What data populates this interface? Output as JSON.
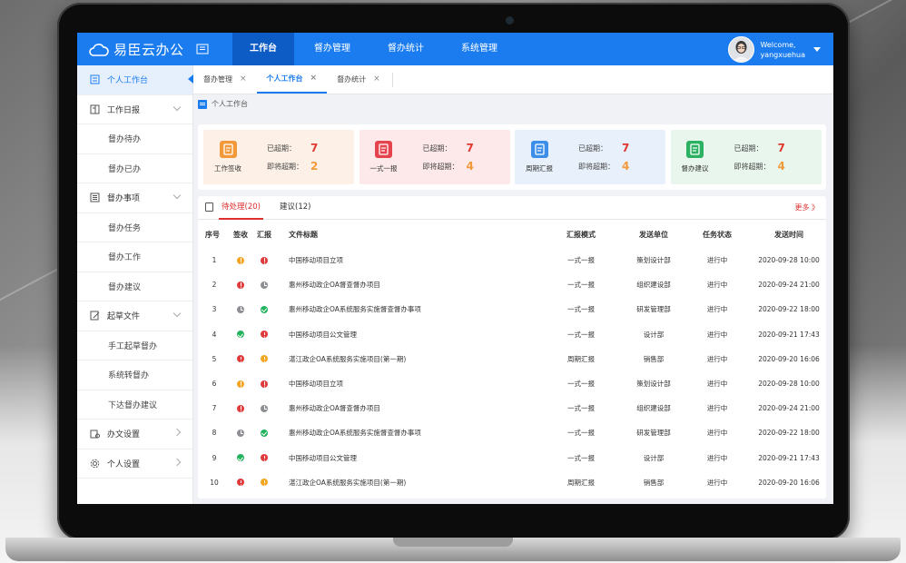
{
  "app": {
    "title": "易臣云办公"
  },
  "nav": [
    {
      "label": "工作台",
      "active": true
    },
    {
      "label": "督办管理",
      "active": false
    },
    {
      "label": "督办统计",
      "active": false
    },
    {
      "label": "系统管理",
      "active": false
    }
  ],
  "user": {
    "welcome": "Welcome,",
    "name": "yangxuehua"
  },
  "sidebar": [
    {
      "label": "个人工作台",
      "type": "top",
      "icon": "home-icon",
      "active": true,
      "arrow": ""
    },
    {
      "label": "工作日报",
      "type": "top",
      "icon": "report-icon",
      "active": false,
      "arrow": "down"
    },
    {
      "label": "督办待办",
      "type": "sub",
      "active": false
    },
    {
      "label": "督办已办",
      "type": "sub",
      "active": false
    },
    {
      "label": "督办事项",
      "type": "top",
      "icon": "list-icon",
      "active": false,
      "arrow": "down"
    },
    {
      "label": "督办任务",
      "type": "sub",
      "active": false
    },
    {
      "label": "督办工作",
      "type": "sub",
      "active": false
    },
    {
      "label": "督办建议",
      "type": "sub",
      "active": false
    },
    {
      "label": "起草文件",
      "type": "top",
      "icon": "edit-icon",
      "active": false,
      "arrow": "down"
    },
    {
      "label": "手工起草督办",
      "type": "sub",
      "active": false
    },
    {
      "label": "系统转督办",
      "type": "sub",
      "active": false
    },
    {
      "label": "下达督办建议",
      "type": "sub",
      "active": false
    },
    {
      "label": "办文设置",
      "type": "top",
      "icon": "document-settings-icon",
      "active": false,
      "arrow": "right"
    },
    {
      "label": "个人设置",
      "type": "top",
      "icon": "gear-icon",
      "active": false,
      "arrow": "right"
    }
  ],
  "tabs": [
    {
      "label": "督办管理",
      "active": false
    },
    {
      "label": "个人工作台",
      "active": true
    },
    {
      "label": "督办统计",
      "active": false
    }
  ],
  "tab_close_glyph": "×",
  "breadcrumb": "个人工作台",
  "stats": {
    "overdue_label": "已超期：",
    "soon_label": "即将超期：",
    "cards": [
      {
        "name": "工作签收",
        "overdue": "7",
        "soon": "2",
        "bg": "#fdf1e7",
        "icon_bg": "#f29a3a",
        "num_color": "#e0392f",
        "soon_color": "#f29a3a"
      },
      {
        "name": "一式一报",
        "overdue": "7",
        "soon": "4",
        "bg": "#fde9ea",
        "icon_bg": "#e5434d",
        "num_color": "#e0392f",
        "soon_color": "#f29a3a"
      },
      {
        "name": "周期汇报",
        "overdue": "7",
        "soon": "4",
        "bg": "#e8f1fb",
        "icon_bg": "#3d8ee8",
        "num_color": "#e0392f",
        "soon_color": "#f29a3a"
      },
      {
        "name": "督办建议",
        "overdue": "7",
        "soon": "4",
        "bg": "#e8f6ed",
        "icon_bg": "#2cb062",
        "num_color": "#e0392f",
        "soon_color": "#f29a3a"
      }
    ]
  },
  "list": {
    "tabs": [
      {
        "label": "待处理(20)",
        "active": true
      },
      {
        "label": "建议(12)",
        "active": false
      }
    ],
    "more": "更多 》",
    "columns": [
      "序号",
      "签收",
      "汇报",
      "文件标题",
      "汇报模式",
      "发送单位",
      "任务状态",
      "发送时间"
    ],
    "rows": [
      {
        "no": "1",
        "sign": "warn",
        "report": "err",
        "title": "中国移动项目立项",
        "mode": "一式一报",
        "unit": "策划设计部",
        "status": "进行中",
        "time": "2020-09-28 10:00"
      },
      {
        "no": "2",
        "sign": "err",
        "report": "pend",
        "title": "惠州移动政企OA督查督办项目",
        "mode": "一式一报",
        "unit": "组织建设部",
        "status": "进行中",
        "time": "2020-09-24 21:00"
      },
      {
        "no": "3",
        "sign": "pend",
        "report": "ok",
        "title": "惠州移动政企OA系统服务实施督查督办事项",
        "mode": "一式一报",
        "unit": "研发管理部",
        "status": "进行中",
        "time": "2020-09-22 18:00"
      },
      {
        "no": "4",
        "sign": "ok",
        "report": "err",
        "title": "中国移动项目公文管理",
        "mode": "一式一报",
        "unit": "设计部",
        "status": "进行中",
        "time": "2020-09-21 17:43"
      },
      {
        "no": "5",
        "sign": "err",
        "report": "warn",
        "title": "湛江政企OA系统服务实施项目(第一期)",
        "mode": "周期汇报",
        "unit": "销售部",
        "status": "进行中",
        "time": "2020-09-20 16:06"
      },
      {
        "no": "6",
        "sign": "warn",
        "report": "err",
        "title": "中国移动项目立项",
        "mode": "一式一报",
        "unit": "策划设计部",
        "status": "进行中",
        "time": "2020-09-28 10:00"
      },
      {
        "no": "7",
        "sign": "err",
        "report": "pend",
        "title": "惠州移动政企OA督查督办项目",
        "mode": "一式一报",
        "unit": "组织建设部",
        "status": "进行中",
        "time": "2020-09-24 21:00"
      },
      {
        "no": "8",
        "sign": "pend",
        "report": "ok",
        "title": "惠州移动政企OA系统服务实施督查督办事项",
        "mode": "一式一报",
        "unit": "研发管理部",
        "status": "进行中",
        "time": "2020-09-22 18:00"
      },
      {
        "no": "9",
        "sign": "ok",
        "report": "err",
        "title": "中国移动项目公文管理",
        "mode": "一式一报",
        "unit": "设计部",
        "status": "进行中",
        "time": "2020-09-21 17:43"
      },
      {
        "no": "10",
        "sign": "err",
        "report": "warn",
        "title": "湛江政企OA系统服务实施项目(第一期)",
        "mode": "周期汇报",
        "unit": "销售部",
        "status": "进行中",
        "time": "2020-09-20 16:06"
      }
    ]
  }
}
